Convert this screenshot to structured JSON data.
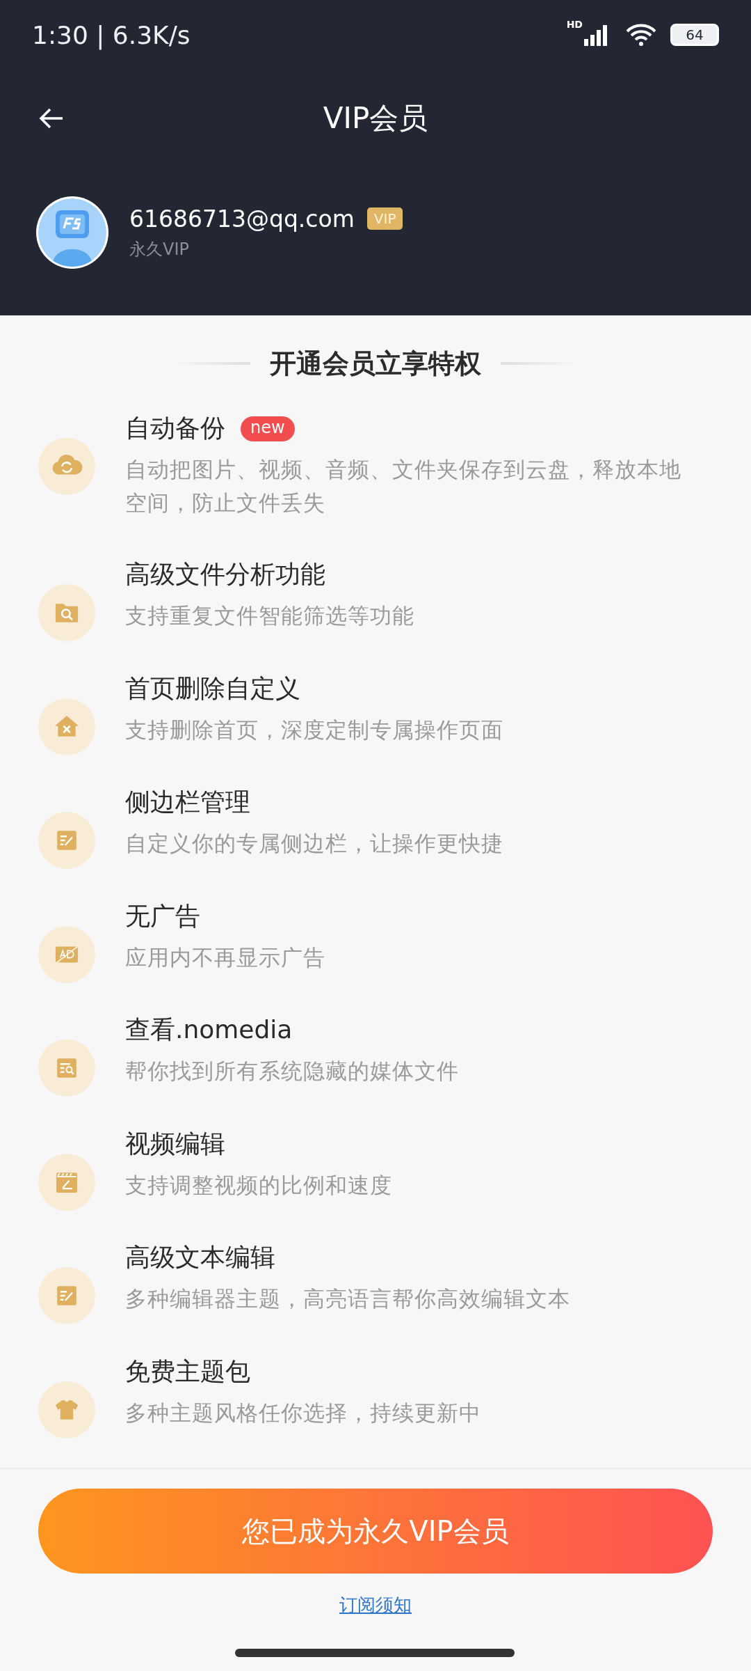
{
  "status_bar": {
    "time": "1:30 | 6.3K/s",
    "network": "HD",
    "battery": "64"
  },
  "header": {
    "title": "VIP会员"
  },
  "profile": {
    "email": "61686713@qq.com",
    "badge": "VIP",
    "subtitle": "永久VIP"
  },
  "section_title": "开通会员立享特权",
  "features": [
    {
      "title": "自动备份",
      "tag": "new",
      "description": "自动把图片、视频、音频、文件夹保存到云盘，释放本地空间，防止文件丢失"
    },
    {
      "title": "高级文件分析功能",
      "description": "支持重复文件智能筛选等功能"
    },
    {
      "title": "首页删除自定义",
      "description": "支持删除首页，深度定制专属操作页面"
    },
    {
      "title": "侧边栏管理",
      "description": "自定义你的专属侧边栏，让操作更快捷"
    },
    {
      "title": "无广告",
      "description": "应用内不再显示广告"
    },
    {
      "title": "查看.nomedia",
      "description": "帮你找到所有系统隐藏的媒体文件"
    },
    {
      "title": "视频编辑",
      "description": "支持调整视频的比例和速度"
    },
    {
      "title": "高级文本编辑",
      "description": "多种编辑器主题，高亮语言帮你高效编辑文本"
    },
    {
      "title": "免费主题包",
      "description": "多种主题风格任你选择，持续更新中"
    }
  ],
  "primary_button": "您已成为永久VIP会员",
  "link": "订阅须知"
}
